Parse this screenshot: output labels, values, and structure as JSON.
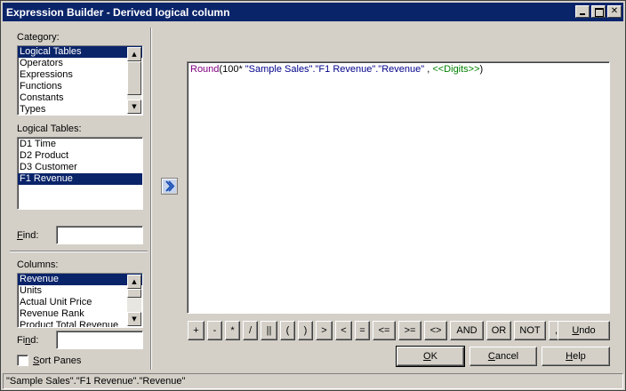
{
  "window": {
    "title": "Expression Builder - Derived logical column"
  },
  "category": {
    "label": "Category:",
    "items": [
      "Logical Tables",
      "Operators",
      "Expressions",
      "Functions",
      "Constants",
      "Types"
    ],
    "selected": 0
  },
  "logical_tables": {
    "label": "Logical Tables:",
    "items": [
      "D1 Time",
      "D2 Product",
      "D3 Customer",
      "F1 Revenue"
    ],
    "selected": 3
  },
  "find_top": {
    "label": "Find:",
    "value": ""
  },
  "columns": {
    "label": "Columns:",
    "items": [
      "Revenue",
      "Units",
      "Actual Unit Price",
      "Revenue Rank",
      "Product Total Revenue"
    ],
    "selected": 0
  },
  "find_bottom": {
    "label": "Find:",
    "value": ""
  },
  "sort_panes": {
    "label": "Sort Panes",
    "checked": false
  },
  "expression": {
    "func": "Round",
    "open": "(100* ",
    "column_ref": "\"Sample Sales\".\"F1 Revenue\".\"Revenue\"",
    "sep": " , ",
    "placeholder": "<<Digits>>",
    "close": ")"
  },
  "operators": [
    "+",
    "-",
    "*",
    "/",
    "||",
    "(",
    ")",
    ">",
    "<",
    "=",
    "<=",
    ">=",
    "<>",
    "AND",
    "OR",
    "NOT",
    ","
  ],
  "buttons": {
    "undo": "Undo",
    "ok": "OK",
    "cancel": "Cancel",
    "help": "Help"
  },
  "status": {
    "text": "\"Sample Sales\".\"F1 Revenue\".\"Revenue\""
  },
  "icons": {
    "insert": "chevron-right-icon",
    "minimize": "minimize-icon",
    "maximize": "maximize-icon",
    "close": "close-icon"
  }
}
